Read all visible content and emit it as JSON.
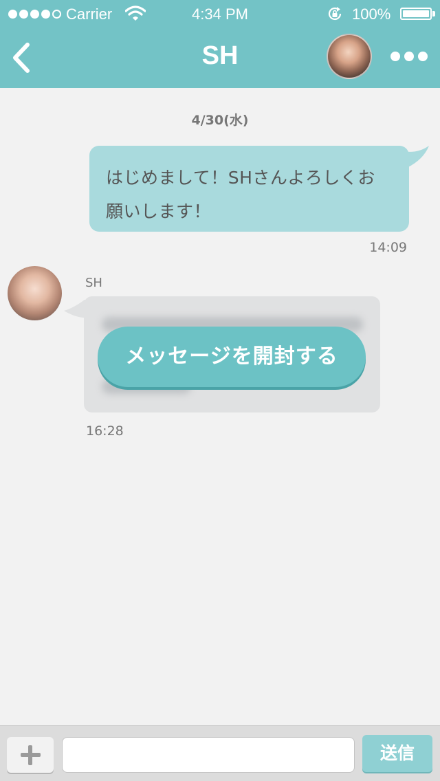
{
  "status_bar": {
    "signal_filled": 4,
    "signal_total": 5,
    "carrier": "Carrier",
    "time": "4:34 PM",
    "battery_percent": "100%"
  },
  "nav": {
    "title": "SH",
    "back_icon": "chevron-left-icon",
    "more_icon": "ellipsis-icon"
  },
  "chat": {
    "date": "4/30(水)",
    "outgoing": {
      "lines": [
        "はじめまして！SHさんよろしくお",
        "願いします！"
      ],
      "time": "14:09"
    },
    "incoming": {
      "sender": "SH",
      "open_button": "メッセージを開封する",
      "time": "16:28"
    }
  },
  "input_bar": {
    "add_icon": "plus-icon",
    "input_value": "",
    "input_placeholder": "",
    "send_label": "送信"
  },
  "colors": {
    "header": "#73c3c6",
    "outgoing_bubble": "#a9dadd",
    "incoming_bubble": "#e0e1e2",
    "open_button": "#6cc2c5",
    "send_button": "#8fd0d3",
    "background": "#f2f2f2"
  }
}
